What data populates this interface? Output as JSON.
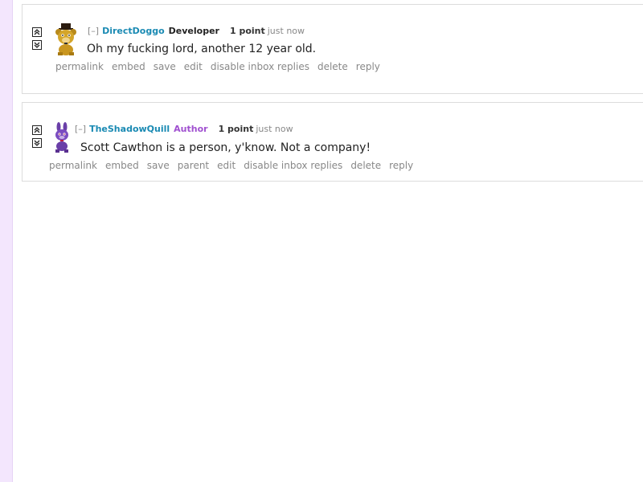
{
  "comments": [
    {
      "collapse_label": "[–]",
      "author": "DirectDoggo",
      "flair": "Developer",
      "score": "1 point",
      "time": "just now",
      "body": "Oh my fucking lord, another 12 year old.",
      "buttons": [
        "permalink",
        "embed",
        "save",
        "edit",
        "disable inbox replies",
        "delete",
        "reply"
      ],
      "avatar_icon": "golden-bear-icon"
    },
    {
      "collapse_label": "[–]",
      "author": "TheShadowQuill",
      "flair": "Author",
      "score": "1 point",
      "time": "just now",
      "body": "Scott Cawthon is a person, y'know. Not a company!",
      "buttons": [
        "permalink",
        "embed",
        "save",
        "parent",
        "edit",
        "disable inbox replies",
        "delete",
        "reply"
      ],
      "avatar_icon": "purple-bunny-icon"
    }
  ],
  "colors": {
    "author_link": "#1a8ab3",
    "author_flair": "#a050d0",
    "sidebar_strip": "#f3e6fd"
  }
}
